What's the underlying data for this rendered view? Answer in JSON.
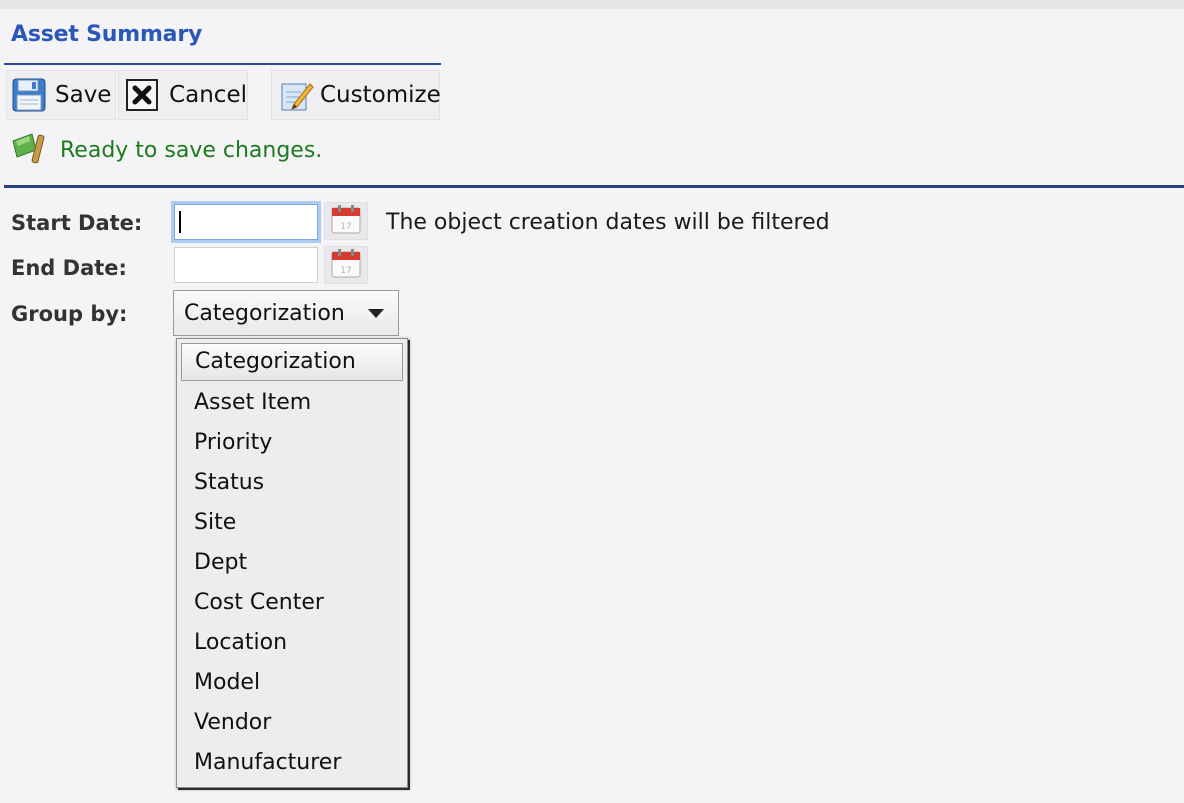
{
  "header": {
    "title": "Asset Summary"
  },
  "toolbar": {
    "save_label": "Save",
    "cancel_label": "Cancel",
    "customize_label": "Customize"
  },
  "status": {
    "message": "Ready to save changes.",
    "color": "#1d7a1d"
  },
  "form": {
    "start_date_label": "Start Date:",
    "start_date_value": "",
    "end_date_label": "End Date:",
    "end_date_value": "",
    "hint": "The object creation dates will be filtered",
    "group_by_label": "Group by:",
    "group_by_selected": "Categorization",
    "group_by_options": [
      "Categorization",
      "Asset Item",
      "Priority",
      "Status",
      "Site",
      "Dept",
      "Cost Center",
      "Location",
      "Model",
      "Vendor",
      "Manufacturer"
    ]
  },
  "colors": {
    "accent": "#2b57b8",
    "rule": "#27427e",
    "focus": "#7ea6e2"
  },
  "icons": {
    "save": "floppy-disk-icon",
    "cancel": "close-x-icon",
    "customize": "pencil-edit-icon",
    "status": "green-flag-icon",
    "calendar": "calendar-icon",
    "dropdown": "chevron-down-icon"
  }
}
